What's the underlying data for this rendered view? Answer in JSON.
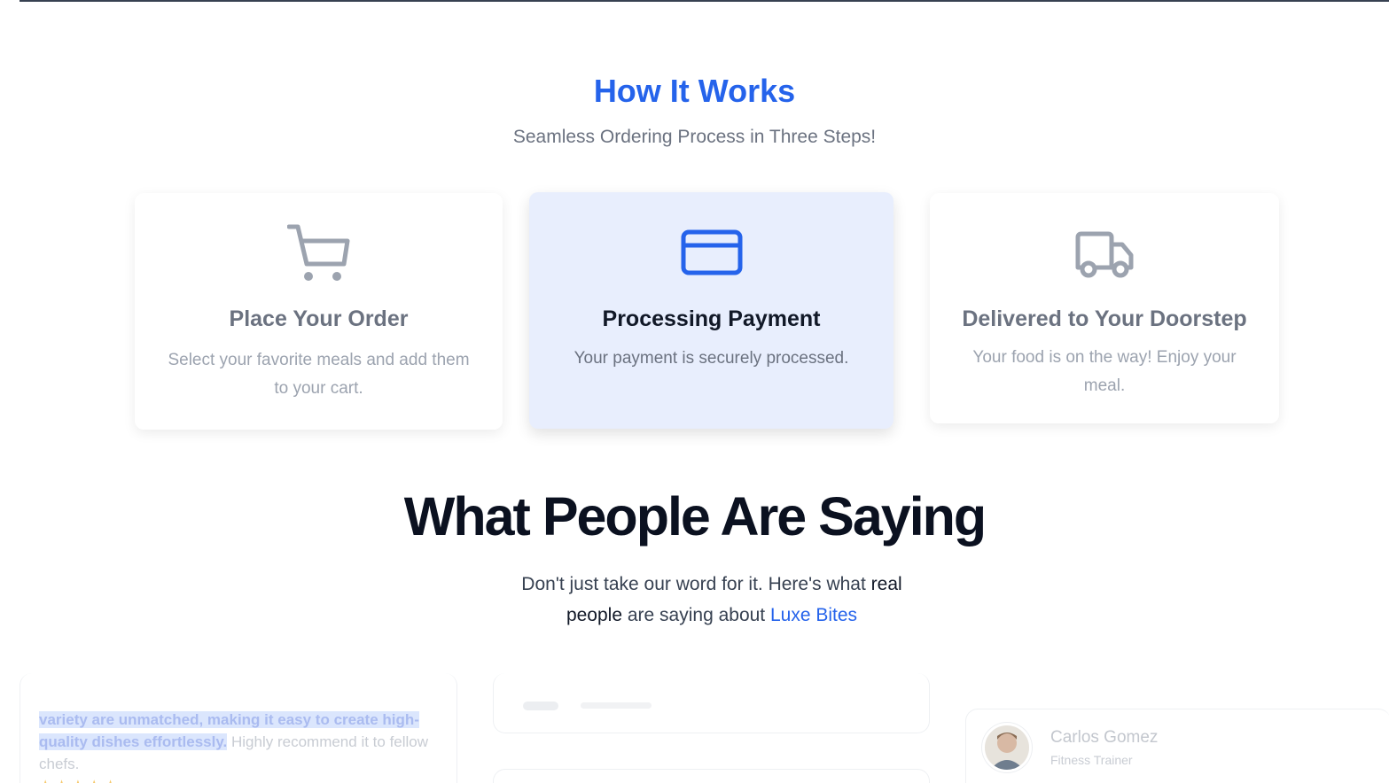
{
  "how": {
    "title": "How It Works",
    "subtitle": "Seamless Ordering Process in Three Steps!"
  },
  "steps": [
    {
      "icon": "cart-icon",
      "title": "Place Your Order",
      "desc": "Select your favorite meals and add them to your cart."
    },
    {
      "icon": "credit-card-icon",
      "title": "Processing Payment",
      "desc": "Your payment is securely processed."
    },
    {
      "icon": "truck-icon",
      "title": "Delivered to Your Doorstep",
      "desc": "Your food is on the way! Enjoy your meal."
    }
  ],
  "testimonials": {
    "title": "What People Are Saying",
    "sub_prefix": "Don't just take our word for it. Here's what",
    "sub_strong": "real people",
    "sub_mid": "are saying about",
    "sub_brand": "Luxe Bites",
    "left_card": {
      "highlight": "variety are unmatched, making it easy to create high-quality dishes effortlessly.",
      "rest": "Highly recommend it to fellow chefs.",
      "stars": "★★★★★"
    },
    "right_card": {
      "name": "Carlos Gomez",
      "role": "Fitness Trainer"
    }
  },
  "colors": {
    "accent": "#2563eb",
    "active_card_bg": "#e8eefd",
    "heading_dark": "#0b1120"
  }
}
